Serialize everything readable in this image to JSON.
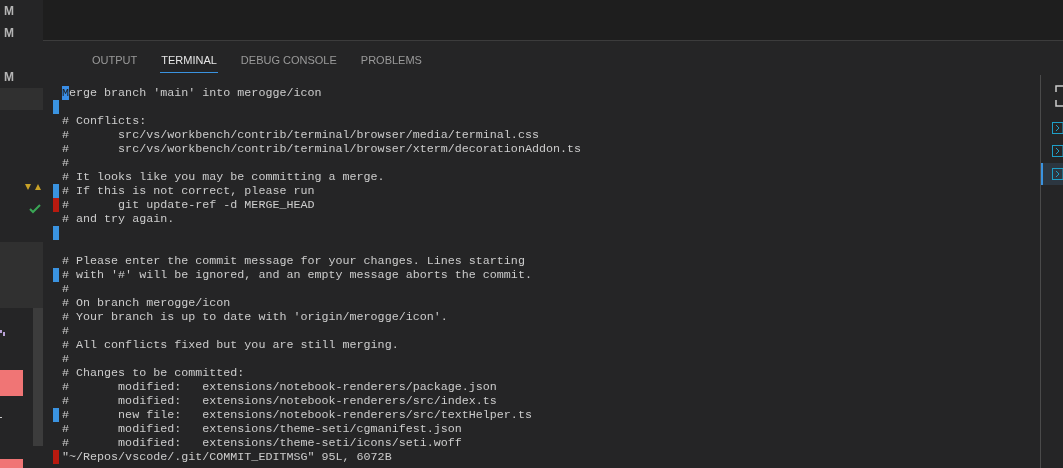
{
  "sidebar": {
    "items": [
      {
        "kind": "letter",
        "text": "M"
      },
      {
        "kind": "letter",
        "text": "M"
      },
      {
        "kind": "gap"
      },
      {
        "kind": "letter",
        "text": "M"
      },
      {
        "kind": "band"
      },
      {
        "kind": "gap"
      },
      {
        "kind": "gap"
      },
      {
        "kind": "gap"
      },
      {
        "kind": "warning"
      },
      {
        "kind": "check"
      },
      {
        "kind": "gap"
      },
      {
        "kind": "band3"
      },
      {
        "kind": "scroll"
      }
    ]
  },
  "panel": {
    "tabs": [
      {
        "label": "OUTPUT",
        "selected": false
      },
      {
        "label": "TERMINAL",
        "selected": true
      },
      {
        "label": "DEBUG CONSOLE",
        "selected": false
      },
      {
        "label": "PROBLEMS",
        "selected": false
      }
    ]
  },
  "editor": {
    "lines": [
      {
        "kind": "text",
        "text": "Merge branch 'main' into merogge/icon",
        "cursor": true
      },
      {
        "kind": "blank",
        "color": "#3a93e0"
      },
      {
        "text": "# Conflicts:"
      },
      {
        "text": "#\tsrc/vs/workbench/contrib/terminal/browser/media/terminal.css"
      },
      {
        "text": "#\tsrc/vs/workbench/contrib/terminal/browser/xterm/decorationAddon.ts"
      },
      {
        "text": "#"
      },
      {
        "text": "# It looks like you may be committing a merge."
      },
      {
        "text": "# If this is not correct, please run",
        "color": "#3a93e0"
      },
      {
        "text": "#\tgit update-ref -d MERGE_HEAD",
        "color": "#b81a0f"
      },
      {
        "text": "# and try again."
      },
      {
        "kind": "blank",
        "color": "#3a93e0"
      },
      {
        "kind": "blank"
      },
      {
        "text": "# Please enter the commit message for your changes. Lines starting"
      },
      {
        "text": "# with '#' will be ignored, and an empty message aborts the commit.",
        "color": "#3a93e0"
      },
      {
        "text": "#"
      },
      {
        "text": "# On branch merogge/icon"
      },
      {
        "text": "# Your branch is up to date with 'origin/merogge/icon'."
      },
      {
        "text": "#"
      },
      {
        "text": "# All conflicts fixed but you are still merging."
      },
      {
        "text": "#"
      },
      {
        "text": "# Changes to be committed:"
      },
      {
        "text": "#\tmodified:   extensions/notebook-renderers/package.json"
      },
      {
        "text": "#\tmodified:   extensions/notebook-renderers/src/index.ts"
      },
      {
        "text": "#\tnew file:   extensions/notebook-renderers/src/textHelper.ts",
        "color": "#3a93e0"
      },
      {
        "text": "#\tmodified:   extensions/theme-seti/cgmanifest.json"
      },
      {
        "text": "#\tmodified:   extensions/theme-seti/icons/seti.woff"
      },
      {
        "text": "\"~/Repos/vscode/.git/COMMIT_EDITMSG\" 95L, 6072B",
        "color": "#b81a0f"
      }
    ]
  },
  "outline": {
    "items": [
      {
        "selected": false
      },
      {
        "selected": false
      },
      {
        "selected": true
      }
    ]
  }
}
